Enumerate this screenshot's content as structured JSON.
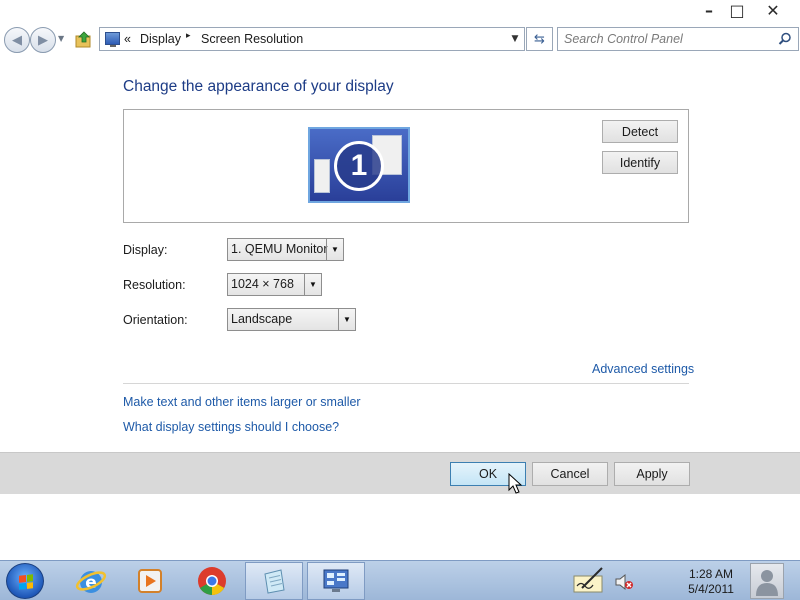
{
  "window": {
    "minimize_glyph": "–",
    "maximize_glyph": "□",
    "close_glyph": "✕"
  },
  "navigation": {
    "back_icon": "back-arrow-icon",
    "forward_icon": "forward-arrow-icon",
    "recent_pages_icon": "chevron-down-icon",
    "up_icon": "up-folder-icon"
  },
  "address_bar": {
    "overflow_glyph": "«",
    "breadcrumbs": [
      "Display",
      "Screen Resolution"
    ],
    "separator_glyph": "▸",
    "dropdown_glyph": "▼",
    "refresh_glyph": "⇆"
  },
  "search": {
    "placeholder": "Search Control Panel",
    "icon": "search-icon"
  },
  "main": {
    "title": "Change the appearance of your display",
    "monitor_number": "1",
    "detect_label": "Detect",
    "identify_label": "Identify",
    "display_label": "Display:",
    "display_value": "1. QEMU Monitor",
    "resolution_label": "Resolution:",
    "resolution_value": "1024 × 768",
    "orientation_label": "Orientation:",
    "orientation_value": "Landscape",
    "dropdown_glyph": "▼",
    "advanced_settings_link": "Advanced settings",
    "text_size_link": "Make text and other items larger or smaller",
    "help_link": "What display settings should I choose?"
  },
  "footer": {
    "ok_label": "OK",
    "cancel_label": "Cancel",
    "apply_label": "Apply"
  },
  "taskbar": {
    "pinned": [
      "internet-explorer-icon",
      "media-player-icon",
      "chrome-icon",
      "notepad-icon",
      "control-panel-icon"
    ],
    "active_item": "control-panel-icon",
    "clock_time": "1:28 AM",
    "clock_date": "5/4/2011"
  },
  "colors": {
    "link": "#1e5aa8",
    "title": "#1d3c86",
    "footer_bg": "#d9d9d9",
    "ok_button": "#c4e5f6",
    "taskbar": "#9db7d8"
  }
}
